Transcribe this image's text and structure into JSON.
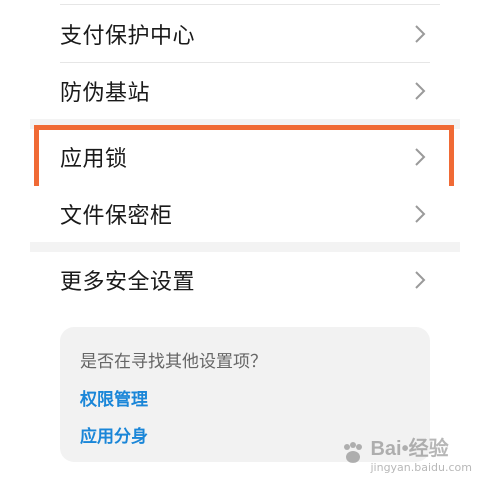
{
  "settings": {
    "items": [
      {
        "label": "支付保护中心"
      },
      {
        "label": "防伪基站"
      },
      {
        "label": "应用锁"
      },
      {
        "label": "文件保密柜"
      },
      {
        "label": "更多安全设置"
      }
    ]
  },
  "suggestion_card": {
    "question": "是否在寻找其他设置项？",
    "links": [
      {
        "label": "权限管理"
      },
      {
        "label": "应用分身"
      }
    ]
  },
  "watermark": {
    "brand": "Bai•经验",
    "sub": "jingyan.baidu.com"
  },
  "colors": {
    "highlight": "#f06a35",
    "link": "#1a86d8",
    "card_bg": "#f2f2f2"
  }
}
